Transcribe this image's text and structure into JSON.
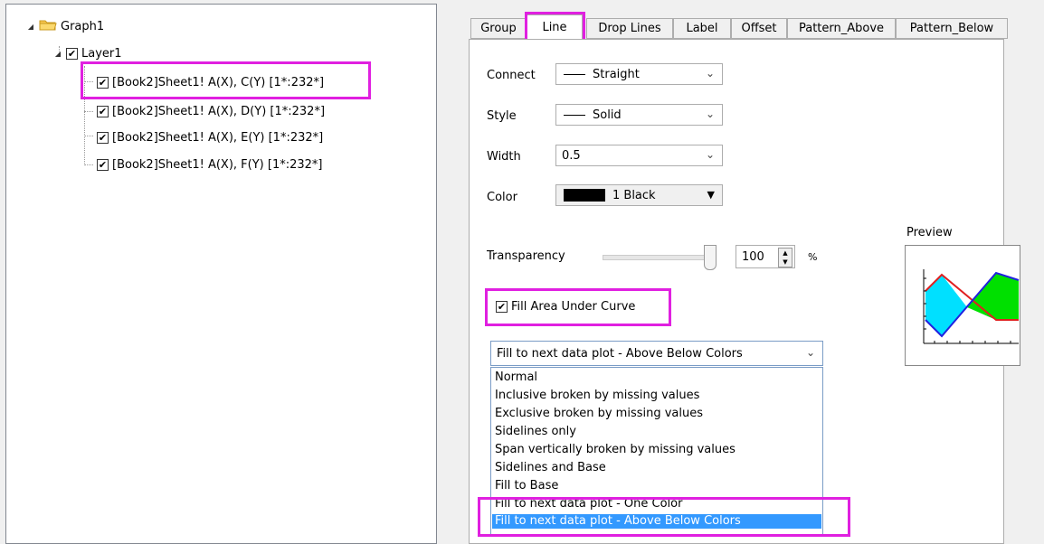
{
  "tree": {
    "root": "Graph1",
    "layer": "Layer1",
    "plots": [
      "[Book2]Sheet1! A(X), C(Y) [1*:232*]",
      "[Book2]Sheet1! A(X), D(Y) [1*:232*]",
      "[Book2]Sheet1! A(X), E(Y) [1*:232*]",
      "[Book2]Sheet1! A(X), F(Y) [1*:232*]"
    ]
  },
  "tabs": [
    "Group",
    "Line",
    "Drop Lines",
    "Label",
    "Offset",
    "Pattern_Above",
    "Pattern_Below"
  ],
  "active_tab": "Line",
  "line": {
    "connect_label": "Connect",
    "connect_value": "Straight",
    "style_label": "Style",
    "style_value": "Solid",
    "width_label": "Width",
    "width_value": "0.5",
    "color_label": "Color",
    "color_value": "1 Black",
    "transparency_label": "Transparency",
    "transparency_value": "100",
    "transparency_unit": "%",
    "transparency_fraction": 1.0,
    "fill_checkbox_label": "Fill Area Under Curve",
    "fill_checked": true,
    "fill_mode_value": "Fill to next data plot - Above Below Colors",
    "fill_options": [
      "Normal",
      "Inclusive broken by missing values",
      "Exclusive broken by missing values",
      "Sidelines only",
      "Span vertically broken by missing values",
      "Sidelines and Base",
      "Fill to Base",
      "Fill to next data plot - One Color",
      "Fill to next data plot - Above Below Colors"
    ]
  },
  "preview": {
    "label": "Preview",
    "colors": {
      "line1": "#e02020",
      "line2": "#2020e0",
      "fill_above": "#00e0ff",
      "fill_below": "#00e000"
    }
  },
  "highlight_color": "#e020e0"
}
